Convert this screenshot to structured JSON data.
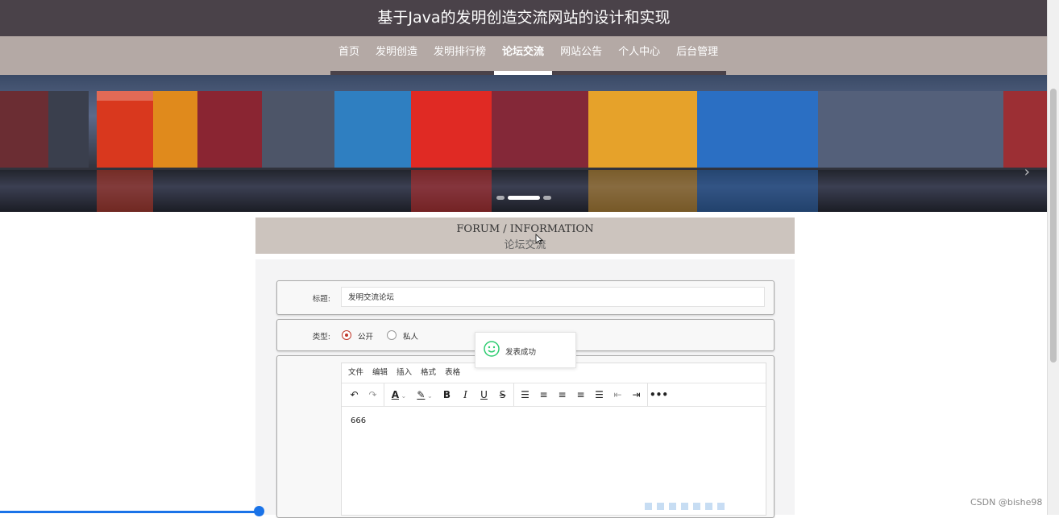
{
  "site": {
    "title": "基于Java的发明创造交流网站的设计和实现"
  },
  "nav": {
    "items": [
      {
        "label": "首页",
        "active": false
      },
      {
        "label": "发明创造",
        "active": false
      },
      {
        "label": "发明排行榜",
        "active": false
      },
      {
        "label": "论坛交流",
        "active": true
      },
      {
        "label": "网站公告",
        "active": false
      },
      {
        "label": "个人中心",
        "active": false
      },
      {
        "label": "后台管理",
        "active": false
      }
    ]
  },
  "banner": {
    "active_slide": 1,
    "slide_count": 3
  },
  "section": {
    "title_en": "FORUM / INFORMATION",
    "title_zh": "论坛交流"
  },
  "form": {
    "title_label": "标题:",
    "title_value": "发明交流论坛",
    "type_label": "类型:",
    "type_options": [
      {
        "label": "公开",
        "checked": true
      },
      {
        "label": "私人",
        "checked": false
      }
    ],
    "editor": {
      "menu": [
        "文件",
        "编辑",
        "插入",
        "格式",
        "表格"
      ],
      "toolbar": [
        "undo-icon",
        "redo-icon",
        "font-color-icon",
        "highlight-icon",
        "bold-icon",
        "italic-icon",
        "underline-icon",
        "strikethrough-icon",
        "line-height-icon",
        "align-left-icon",
        "align-center-icon",
        "align-right-icon",
        "justify-icon",
        "outdent-icon",
        "indent-icon",
        "more-icon"
      ],
      "content": "666"
    }
  },
  "toast": {
    "message": "发表成功",
    "icon": "smile-icon"
  },
  "watermark": "CSDN @bishe98",
  "colors": {
    "title_bar": "#4a4249",
    "nav": "#b4a9a5",
    "section_header": "#ccc4be",
    "toast_icon": "#2ecc71",
    "radio_checked": "#c0392b"
  }
}
